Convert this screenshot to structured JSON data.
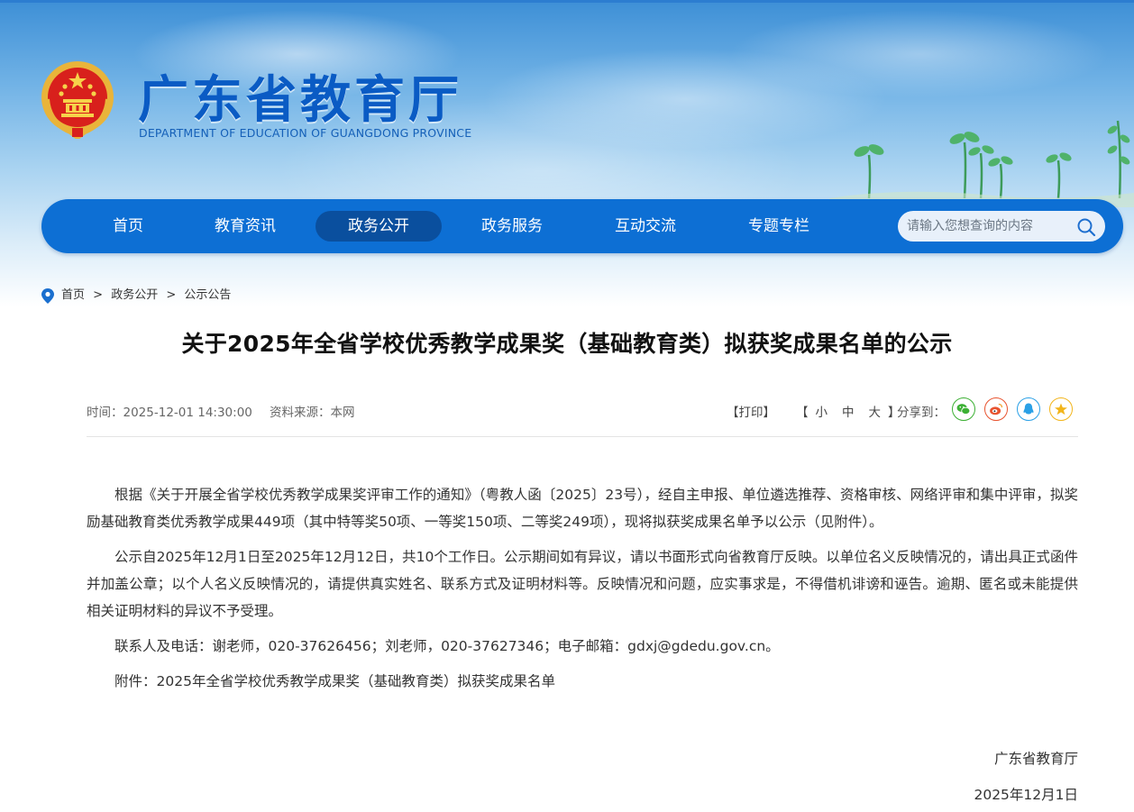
{
  "site": {
    "title": "广东省教育厅",
    "subtitle": "DEPARTMENT OF EDUCATION OF GUANGDONG PROVINCE"
  },
  "nav": {
    "items": [
      {
        "label": "首页"
      },
      {
        "label": "教育资讯"
      },
      {
        "label": "政务公开",
        "active": true
      },
      {
        "label": "政务服务"
      },
      {
        "label": "互动交流"
      },
      {
        "label": "专题专栏"
      }
    ],
    "search_placeholder": "请输入您想查询的内容",
    "bar_color": "#0d6fd4",
    "active_color": "#0a4f9e"
  },
  "breadcrumb": {
    "items": [
      "首页",
      "政务公开",
      "公示公告"
    ],
    "separator": ">"
  },
  "article": {
    "title": "关于2025年全省学校优秀教学成果奖（基础教育类）拟获奖成果名单的公示",
    "time": "时间：2025-12-01 14:30:00",
    "source": "资料来源：本网",
    "print_label": "【打印】",
    "font_sizes": {
      "open": "【",
      "small": "小",
      "medium": "中",
      "large": "大",
      "close": "】"
    },
    "share_label": "分享到：",
    "share_icons": [
      {
        "name": "wechat-icon",
        "color": "#3cb034"
      },
      {
        "name": "weibo-icon",
        "color": "#e8532f"
      },
      {
        "name": "qq-icon",
        "color": "#2aa0e6"
      },
      {
        "name": "qzone-icon",
        "color": "#f2b51b"
      }
    ],
    "paragraphs": [
      "根据《关于开展全省学校优秀教学成果奖评审工作的通知》（粤教人函〔2025〕23号），经自主申报、单位遴选推荐、资格审核、网络评审和集中评审，拟奖励基础教育类优秀教学成果449项（其中特等奖50项、一等奖150项、二等奖249项），现将拟获奖成果名单予以公示（见附件）。",
      "公示自2025年12月1日至2025年12月12日，共10个工作日。公示期间如有异议，请以书面形式向省教育厅反映。以单位名义反映情况的，请出具正式函件并加盖公章；以个人名义反映情况的，请提供真实姓名、联系方式及证明材料等。反映情况和问题，应实事求是，不得借机诽谤和诬告。逾期、匿名或未能提供相关证明材料的异议不予受理。",
      "联系人及电话：谢老师，020-37626456；刘老师，020-37627346；电子邮箱：gdxj@gdedu.gov.cn。",
      "附件：2025年全省学校优秀教学成果奖（基础教育类）拟获奖成果名单"
    ],
    "signature_org": "广东省教育厅",
    "signature_date": "2025年12月1日"
  }
}
